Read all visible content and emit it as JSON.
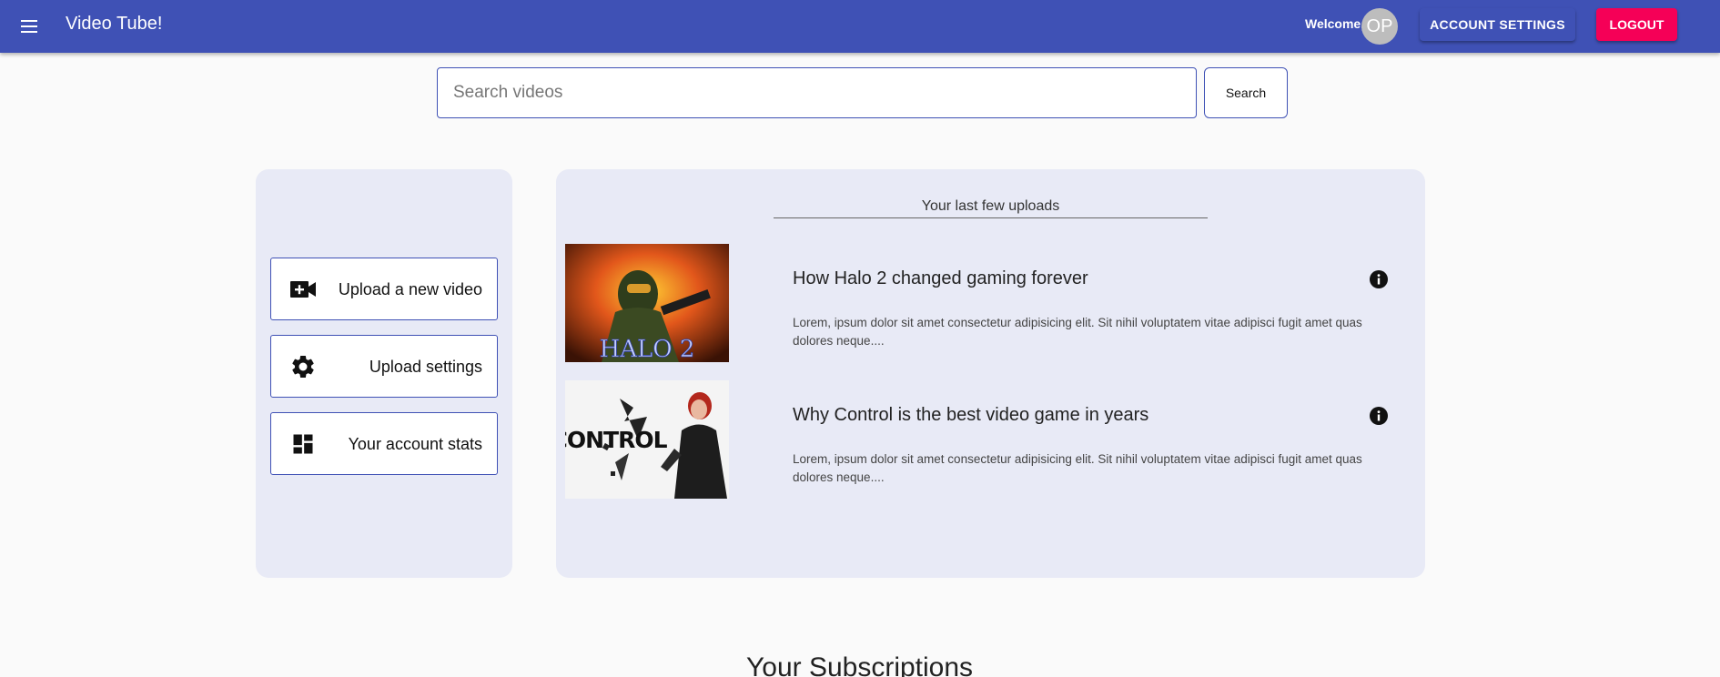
{
  "appbar": {
    "title": "Video Tube!",
    "menu_icon": "hamburger-menu-icon",
    "welcome": "Welcome,",
    "avatar_initials": "OP",
    "account_settings_label": "ACCOUNT SETTINGS",
    "logout_label": "LOGOUT",
    "colors": {
      "primary": "#3f51b5",
      "secondary": "#f50057"
    }
  },
  "search": {
    "placeholder": "Search videos",
    "value": "",
    "button_label": "Search"
  },
  "sidebar": {
    "items": [
      {
        "label": "Upload a new video",
        "icon": "video-camera-add-icon"
      },
      {
        "label": "Upload settings",
        "icon": "gear-icon"
      },
      {
        "label": "Your account stats",
        "icon": "dashboard-icon"
      }
    ]
  },
  "uploads": {
    "title": "Your last few uploads",
    "videos": [
      {
        "title": "How Halo 2 changed gaming forever",
        "description": "Lorem, ipsum dolor sit amet consectetur adipisicing elit. Sit nihil voluptatem vitae adipisci fugit amet quas dolores neque....",
        "thumbnail_text": "HALO 2"
      },
      {
        "title": "Why Control is the best video game in years",
        "description": "Lorem, ipsum dolor sit amet consectetur adipisicing elit. Sit nihil voluptatem vitae adipisci fugit amet quas dolores neque....",
        "thumbnail_text": "CONTROL"
      }
    ]
  },
  "subscriptions": {
    "title": "Your Subscriptions"
  }
}
